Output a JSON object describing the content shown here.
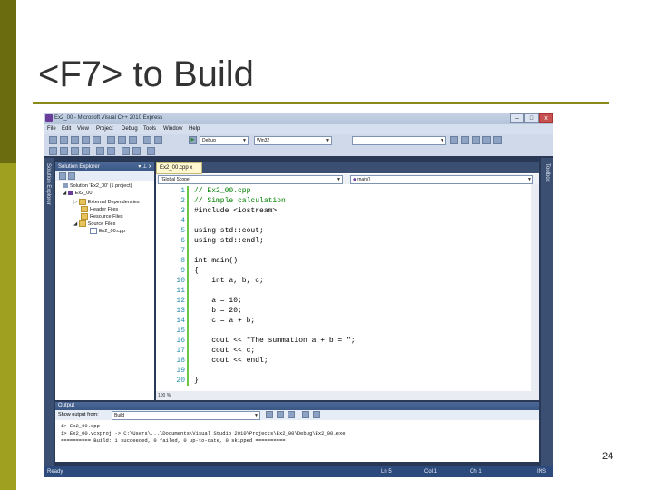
{
  "slide": {
    "title": "<F7> to Build",
    "page_number": "24"
  },
  "window": {
    "title": "Ex2_00 - Microsoft Visual C++ 2010 Express",
    "min": "–",
    "max": "□",
    "close": "x"
  },
  "menu": [
    "File",
    "Edit",
    "View",
    "Project",
    "Debug",
    "Tools",
    "Window",
    "Help"
  ],
  "toolbar": {
    "configuration": "Debug",
    "platform": "Win32",
    "search": ""
  },
  "side_tabs": {
    "left": "Solution Explorer",
    "right": "Toolbox"
  },
  "solution_explorer": {
    "title": "Solution Explorer",
    "items": [
      {
        "label": "Solution 'Ex2_00' (1 project)",
        "icon": "solution-icon"
      },
      {
        "label": "Ex2_00",
        "icon": "project-icon"
      },
      {
        "label": "External Dependencies",
        "icon": "folder-icon"
      },
      {
        "label": "Header Files",
        "icon": "folder-icon"
      },
      {
        "label": "Resource Files",
        "icon": "folder-icon"
      },
      {
        "label": "Source Files",
        "icon": "folder-icon"
      },
      {
        "label": "Ex2_00.cpp",
        "icon": "cpp-file-icon"
      }
    ]
  },
  "editor": {
    "tab": "Ex2_00.cpp",
    "scope": "(Global Scope)",
    "function": "main()",
    "zoom": "100 %",
    "lines": [
      {
        "n": "1",
        "text": "// Ex2_00.cpp",
        "color": "#008000"
      },
      {
        "n": "2",
        "text": "// Simple calculation",
        "color": "#008000"
      },
      {
        "n": "3",
        "text": "#include <iostream>",
        "color": "#000000"
      },
      {
        "n": "4",
        "text": "",
        "color": "#000000"
      },
      {
        "n": "5",
        "text": "using std::cout;",
        "color": "#000000"
      },
      {
        "n": "6",
        "text": "using std::endl;",
        "color": "#000000"
      },
      {
        "n": "7",
        "text": "",
        "color": "#000000"
      },
      {
        "n": "8",
        "text": "int main()",
        "color": "#000000"
      },
      {
        "n": "9",
        "text": "{",
        "color": "#000000"
      },
      {
        "n": "10",
        "text": "    int a, b, c;",
        "color": "#000000"
      },
      {
        "n": "11",
        "text": "",
        "color": "#000000"
      },
      {
        "n": "12",
        "text": "    a = 10;",
        "color": "#000000"
      },
      {
        "n": "13",
        "text": "    b = 20;",
        "color": "#000000"
      },
      {
        "n": "14",
        "text": "    c = a + b;",
        "color": "#000000"
      },
      {
        "n": "15",
        "text": "",
        "color": "#000000"
      },
      {
        "n": "16",
        "text": "    cout << \"The summation a + b = \";",
        "color": "#000000"
      },
      {
        "n": "17",
        "text": "    cout << c;",
        "color": "#000000"
      },
      {
        "n": "18",
        "text": "    cout << endl;",
        "color": "#000000"
      },
      {
        "n": "19",
        "text": "",
        "color": "#000000"
      },
      {
        "n": "20",
        "text": "}",
        "color": "#000000"
      }
    ]
  },
  "output": {
    "title": "Output",
    "show_from_label": "Show output from:",
    "show_from_value": "Build",
    "lines": [
      "1>  Ex2_00.cpp",
      "1>  Ex2_00.vcxproj -> C:\\Users\\...\\Documents\\Visual Studio 2010\\Projects\\Ex2_00\\Debug\\Ex2_00.exe",
      "========== Build: 1 succeeded, 0 failed, 0 up-to-date, 0 skipped =========="
    ]
  },
  "status": {
    "ready": "Ready",
    "ln": "Ln 5",
    "col": "Col 1",
    "ch": "Ch 1",
    "ins": "INS"
  }
}
